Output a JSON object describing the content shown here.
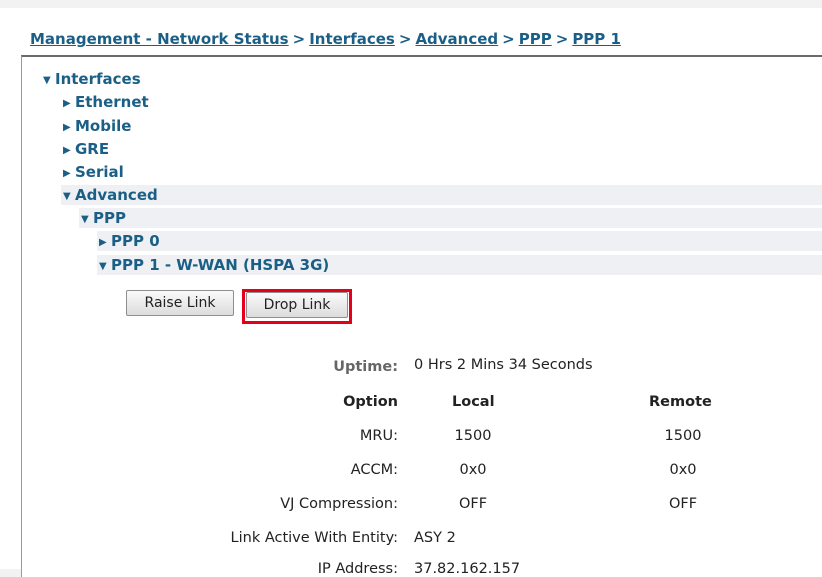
{
  "breadcrumb": {
    "items": [
      "Management - Network Status",
      "Interfaces",
      "Advanced",
      "PPP",
      "PPP 1"
    ],
    "separator": ">"
  },
  "tree": {
    "interfaces": "Interfaces",
    "ethernet": "Ethernet",
    "mobile": "Mobile",
    "gre": "GRE",
    "serial": "Serial",
    "advanced": "Advanced",
    "ppp": "PPP",
    "ppp0": "PPP 0",
    "ppp1": "PPP 1 - W-WAN (HSPA 3G)"
  },
  "buttons": {
    "raise_link": "Raise Link",
    "drop_link": "Drop Link"
  },
  "status": {
    "uptime_label": "Uptime:",
    "uptime_value": "0 Hrs 2 Mins 34 Seconds",
    "headers": {
      "option": "Option",
      "local": "Local",
      "remote": "Remote"
    },
    "rows": [
      {
        "option": "MRU:",
        "local": "1500",
        "remote": "1500"
      },
      {
        "option": "ACCM:",
        "local": "0x0",
        "remote": "0x0"
      },
      {
        "option": "VJ Compression:",
        "local": "OFF",
        "remote": "OFF"
      }
    ],
    "link_active_label": "Link Active With Entity:",
    "link_active_value": "ASY 2",
    "ip_label_partial": "IP Address:",
    "ip_value_partial": "37.82.162.157"
  },
  "colors": {
    "link": "#1b5f86",
    "highlight": "#e4001b"
  },
  "icons": {
    "expanded": "triangle-down-icon",
    "collapsed": "triangle-right-icon"
  }
}
